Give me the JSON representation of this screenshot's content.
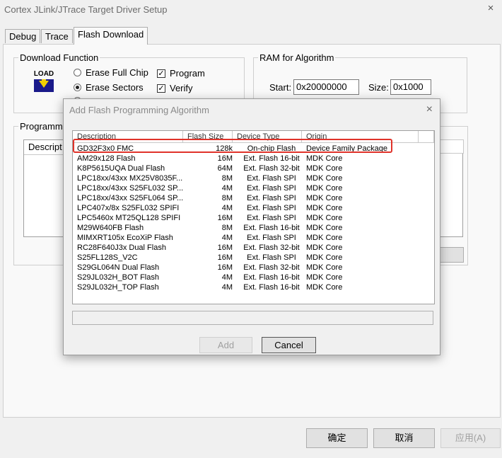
{
  "window": {
    "title": "Cortex JLink/JTrace Target Driver Setup",
    "close_glyph": "×"
  },
  "tabs": [
    "Debug",
    "Trace",
    "Flash Download"
  ],
  "download_function": {
    "label": "Download Function",
    "load_icon_text": "LOAD",
    "erase_full_chip": "Erase Full Chip",
    "erase_sectors": "Erase Sectors",
    "program": "Program",
    "verify": "Verify",
    "selected": "Erase Sectors",
    "program_checked": true,
    "verify_checked": true
  },
  "ram": {
    "label": "RAM for Algorithm",
    "start_label": "Start:",
    "start_value": "0x20000000",
    "size_label": "Size:",
    "size_value": "0x1000"
  },
  "programming": {
    "label": "Programm",
    "column_header": "Descript"
  },
  "dialog": {
    "title": "Add Flash Programming Algorithm",
    "columns": [
      "Description",
      "Flash Size",
      "Device Type",
      "Origin"
    ],
    "rows": [
      [
        "GD32F3x0 FMC",
        "128k",
        "On-chip Flash",
        "Device Family Package"
      ],
      [
        "AM29x128 Flash",
        "16M",
        "Ext. Flash 16-bit",
        "MDK Core"
      ],
      [
        "K8P5615UQA Dual Flash",
        "64M",
        "Ext. Flash 32-bit",
        "MDK Core"
      ],
      [
        "LPC18xx/43xx MX25V8035F...",
        "8M",
        "Ext. Flash SPI",
        "MDK Core"
      ],
      [
        "LPC18xx/43xx S25FL032 SP...",
        "4M",
        "Ext. Flash SPI",
        "MDK Core"
      ],
      [
        "LPC18xx/43xx S25FL064 SP...",
        "8M",
        "Ext. Flash SPI",
        "MDK Core"
      ],
      [
        "LPC407x/8x S25FL032 SPIFI",
        "4M",
        "Ext. Flash SPI",
        "MDK Core"
      ],
      [
        "LPC5460x MT25QL128 SPIFI",
        "16M",
        "Ext. Flash SPI",
        "MDK Core"
      ],
      [
        "M29W640FB Flash",
        "8M",
        "Ext. Flash 16-bit",
        "MDK Core"
      ],
      [
        "MIMXRT105x EcoXiP Flash",
        "4M",
        "Ext. Flash SPI",
        "MDK Core"
      ],
      [
        "RC28F640J3x Dual Flash",
        "16M",
        "Ext. Flash 32-bit",
        "MDK Core"
      ],
      [
        "S25FL128S_V2C",
        "16M",
        "Ext. Flash SPI",
        "MDK Core"
      ],
      [
        "S29GL064N Dual Flash",
        "16M",
        "Ext. Flash 32-bit",
        "MDK Core"
      ],
      [
        "S29JL032H_BOT Flash",
        "4M",
        "Ext. Flash 16-bit",
        "MDK Core"
      ],
      [
        "S29JL032H_TOP Flash",
        "4M",
        "Ext. Flash 16-bit",
        "MDK Core"
      ]
    ],
    "add_label": "Add",
    "cancel_label": "Cancel"
  },
  "footer": {
    "ok": "确定",
    "cancel": "取消",
    "apply": "应用(A)"
  },
  "colors": {
    "highlight": "#e0332a",
    "focus": "#0078d7"
  }
}
